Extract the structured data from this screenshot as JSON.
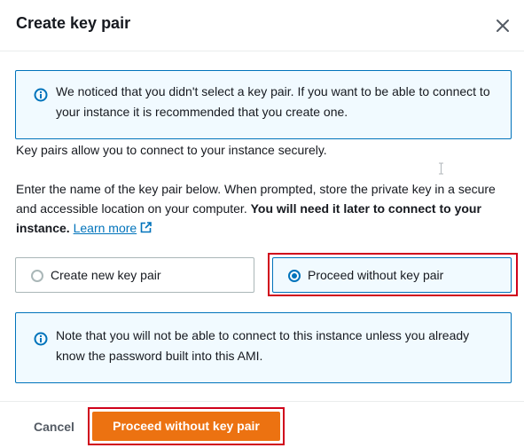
{
  "dialog": {
    "title": "Create key pair",
    "close_icon": "close-icon"
  },
  "notice": {
    "icon": "info-icon",
    "text": "We noticed that you didn't select a key pair. If you want to be able to connect to your instance it is recommended that you create one."
  },
  "intro": {
    "line1": "Key pairs allow you to connect to your instance securely.",
    "line2_text": "Enter the name of the key pair below. When prompted, store the private key in a secure and accessible location on your computer. ",
    "line2_bold": "You will need it later to connect to your instance.",
    "learn_more": "Learn more",
    "external_icon": "external-link-icon"
  },
  "options": [
    {
      "label": "Create new key pair",
      "selected": false
    },
    {
      "label": "Proceed without key pair",
      "selected": true
    }
  ],
  "warning": {
    "icon": "info-icon",
    "text": "Note that you will not be able to connect to this instance unless you already know the password built into this AMI."
  },
  "footer": {
    "cancel_label": "Cancel",
    "primary_label": "Proceed without key pair"
  },
  "colors": {
    "accent": "#0073bb",
    "primary_button": "#ec7211",
    "highlight_outline": "#d0021b"
  }
}
